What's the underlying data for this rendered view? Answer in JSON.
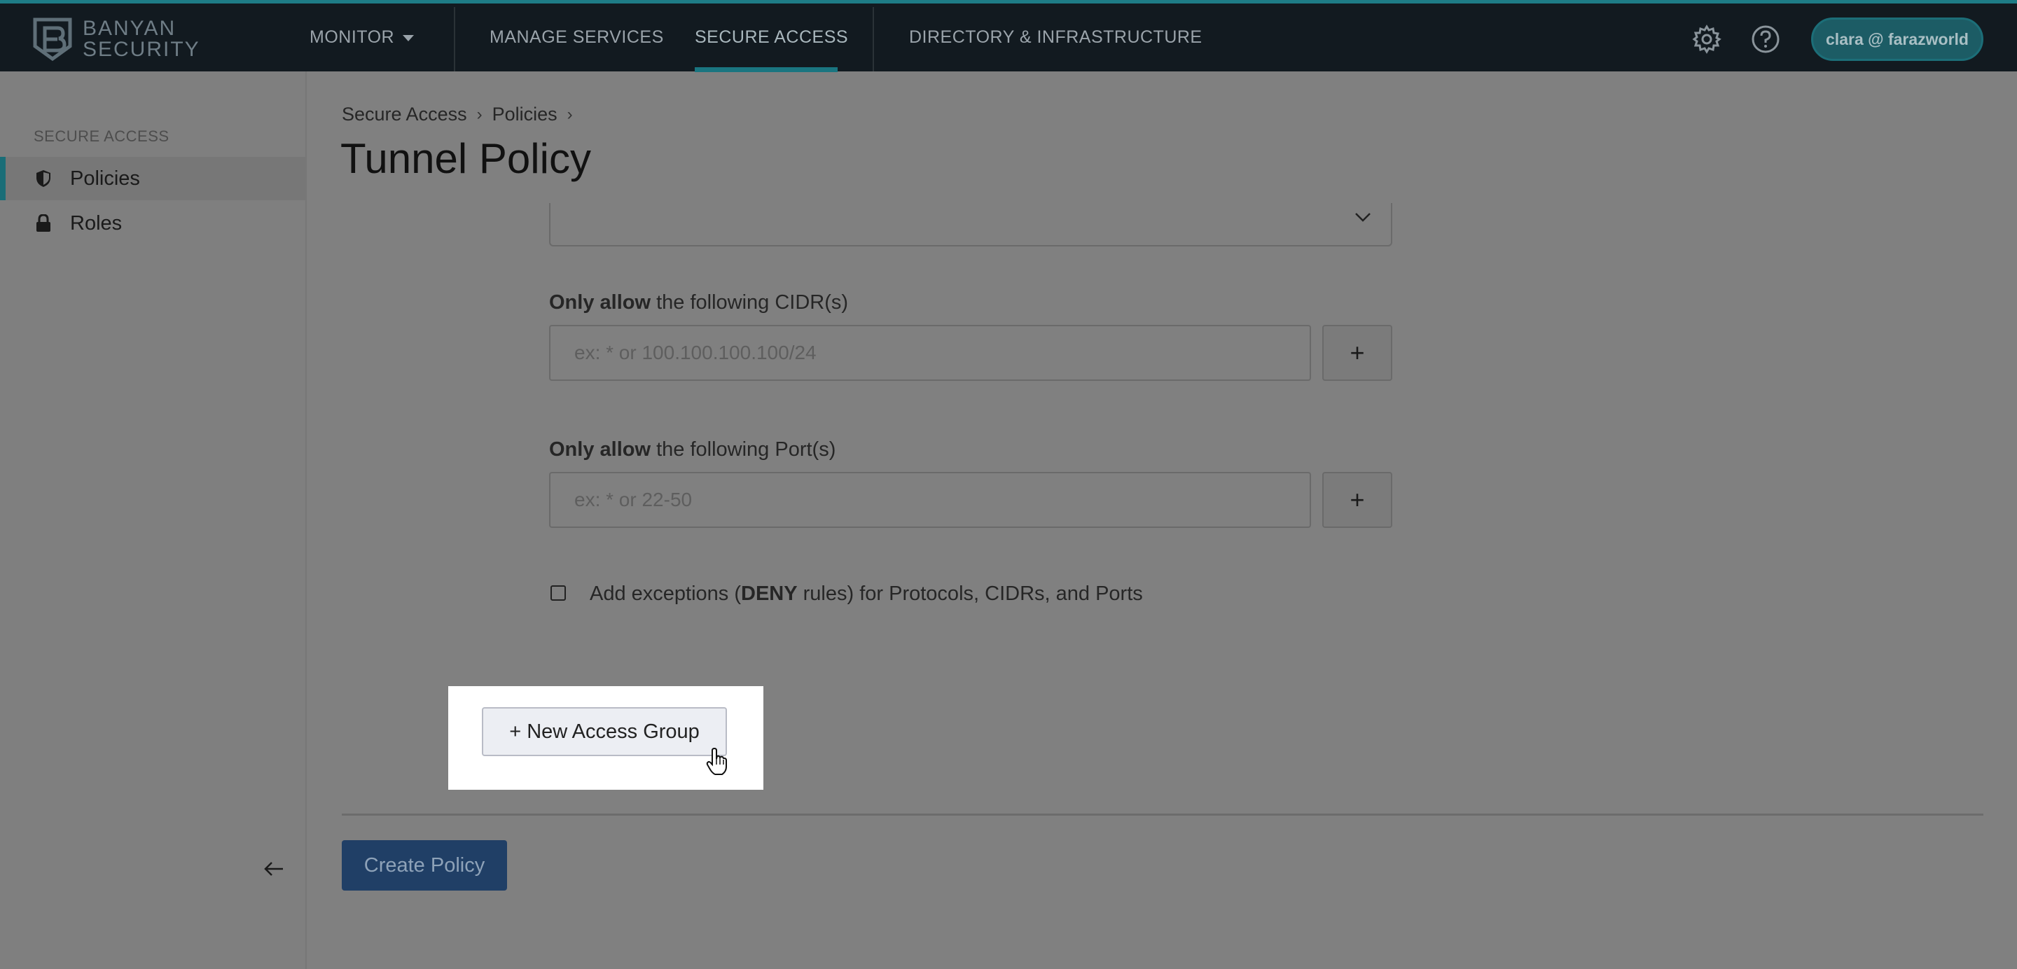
{
  "brand": {
    "line1": "BANYAN",
    "line2": "SECURITY"
  },
  "nav": {
    "monitor": "MONITOR",
    "manage_services": "MANAGE SERVICES",
    "secure_access": "SECURE ACCESS",
    "directory": "DIRECTORY & INFRASTRUCTURE",
    "user": "clara @ farazworld"
  },
  "sidebar": {
    "section": "SECURE ACCESS",
    "items": [
      {
        "label": "Policies",
        "icon": "shield-icon",
        "active": true
      },
      {
        "label": "Roles",
        "icon": "lock-icon",
        "active": false
      }
    ]
  },
  "breadcrumb": [
    "Secure Access",
    "Policies"
  ],
  "page": {
    "title": "Tunnel Policy"
  },
  "form": {
    "cidr_label_bold": "Only allow",
    "cidr_label_rest": " the following CIDR(s)",
    "cidr_placeholder": "ex: * or 100.100.100.100/24",
    "port_label_bold": "Only allow",
    "port_label_rest": " the following Port(s)",
    "port_placeholder": "ex: * or 22-50",
    "add_symbol": "+",
    "exceptions_pre": "Add exceptions (",
    "exceptions_bold": "DENY",
    "exceptions_post": " rules) for Protocols, CIDRs, and Ports",
    "exceptions_checked": false,
    "new_group_label": "+ New Access Group",
    "create_label": "Create Policy"
  },
  "colors": {
    "accent": "#1a7580",
    "primary_button": "#203f66",
    "topbar": "#121a20"
  }
}
